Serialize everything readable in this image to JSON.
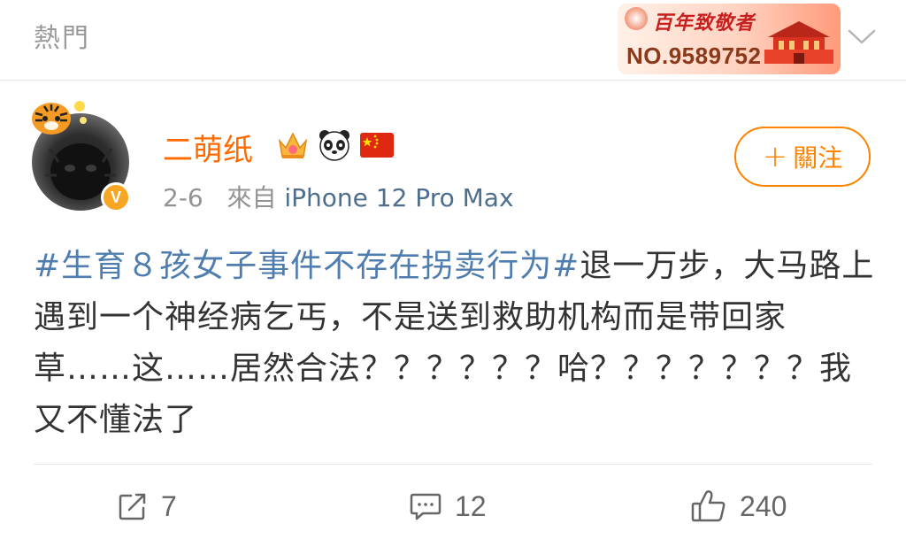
{
  "header": {
    "section_label": "熱門",
    "badge": {
      "title": "百年致敬者",
      "number": "NO.9589752"
    }
  },
  "author": {
    "name": "二萌纸",
    "verified_mark": "V",
    "icons": [
      "crown-icon",
      "panda-icon",
      "china-flag-icon"
    ]
  },
  "meta": {
    "date": "2-6",
    "source_prefix": "來自",
    "device": "iPhone 12 Pro Max"
  },
  "follow": {
    "plus": "+",
    "label": "關注"
  },
  "post": {
    "hashtag": "#生育８孩女子事件不存在拐卖行为#",
    "body": "退一万步，大马路上遇到一个神经病乞丐，不是送到救助机构而是带回家草……这……居然合法？？？？？？哈？？？？？？？我又不懂法了"
  },
  "actions": {
    "reposts": "7",
    "comments": "12",
    "likes": "240"
  },
  "colors": {
    "accent": "#ff8200",
    "username": "#ff6a00",
    "link": "#507daf",
    "muted": "#939393"
  }
}
